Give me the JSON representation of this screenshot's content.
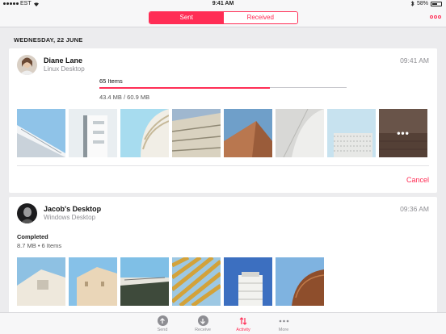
{
  "status_bar": {
    "carrier": "EST",
    "time": "9:41 AM",
    "battery": "58%",
    "battery_level": 0.58
  },
  "nav": {
    "tabs": [
      {
        "label": "Sent",
        "active": true
      },
      {
        "label": "Received",
        "active": false
      }
    ],
    "more_icon": "more-circle-icon"
  },
  "date_header": "WEDNESDAY, 22 JUNE",
  "transfers": [
    {
      "name": "Diane Lane",
      "device": "Linux Desktop",
      "time": "09:41 AM",
      "items_label": "65 Items",
      "progress": 0.69,
      "size_label": "43.4 MB / 60.9 MB",
      "more_label": "•••",
      "cancel_label": "Cancel"
    },
    {
      "name": "Jacob's Desktop",
      "device": "Windows Desktop",
      "time": "09:36 AM",
      "status": "Completed",
      "meta": "8.7 MB • 6 Items"
    }
  ],
  "tab_bar": {
    "items": [
      {
        "label": "Send",
        "icon": "arrow-up-icon"
      },
      {
        "label": "Receive",
        "icon": "arrow-down-icon"
      },
      {
        "label": "Activity",
        "icon": "transfer-arrows-icon",
        "active": true
      },
      {
        "label": "More",
        "icon": "ellipsis-icon"
      }
    ]
  },
  "colors": {
    "accent": "#ff2d55",
    "background": "#ececee",
    "secondary_text": "#8e8e93"
  }
}
